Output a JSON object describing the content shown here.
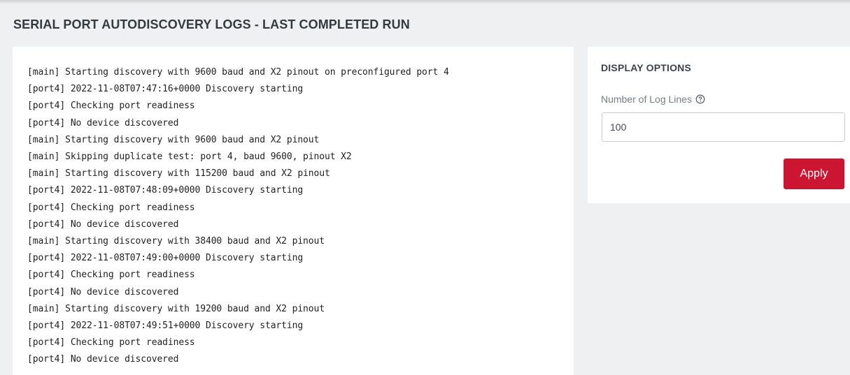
{
  "page": {
    "title": "SERIAL PORT AUTODISCOVERY LOGS - LAST COMPLETED RUN"
  },
  "logs": {
    "lines": [
      "[main] Starting discovery with 9600 baud and X2 pinout on preconfigured port 4",
      "[port4] 2022-11-08T07:47:16+0000 Discovery starting",
      "[port4] Checking port readiness",
      "[port4] No device discovered",
      "[main] Starting discovery with 9600 baud and X2 pinout",
      "[main] Skipping duplicate test: port 4, baud 9600, pinout X2",
      "[main] Starting discovery with 115200 baud and X2 pinout",
      "[port4] 2022-11-08T07:48:09+0000 Discovery starting",
      "[port4] Checking port readiness",
      "[port4] No device discovered",
      "[main] Starting discovery with 38400 baud and X2 pinout",
      "[port4] 2022-11-08T07:49:00+0000 Discovery starting",
      "[port4] Checking port readiness",
      "[port4] No device discovered",
      "[main] Starting discovery with 19200 baud and X2 pinout",
      "[port4] 2022-11-08T07:49:51+0000 Discovery starting",
      "[port4] Checking port readiness",
      "[port4] No device discovered"
    ]
  },
  "display_options": {
    "title": "DISPLAY OPTIONS",
    "log_lines_label": "Number of Log Lines",
    "log_lines_value": "100",
    "help_icon": "question-circle-icon",
    "apply_label": "Apply"
  },
  "colors": {
    "background": "#eef0f2",
    "panel": "#ffffff",
    "accent": "#cc1530"
  }
}
